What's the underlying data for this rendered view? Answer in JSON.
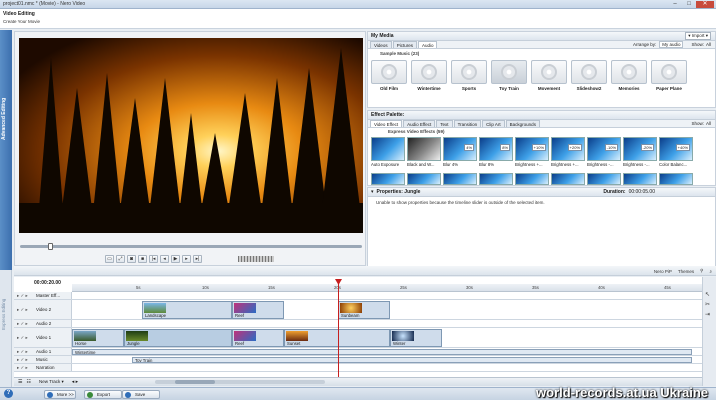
{
  "window": {
    "title": "project01.nmc * (Movie) - Nero Video",
    "min": "–",
    "max": "□",
    "close": "✕"
  },
  "header": {
    "title": "Video Editing",
    "subtitle": "Create Your Movie"
  },
  "left_tab": {
    "label": "Advanced Editing"
  },
  "left_tab2": {
    "label": "Express Editing"
  },
  "my_media": {
    "title": "My Media",
    "import_label": "▾ Import ▾",
    "tabs": [
      "Videos",
      "Pictures",
      "Audio"
    ],
    "arrange_label": "Arrange by:",
    "arrange_value": "My audio",
    "show_label": "Show:",
    "show_value": "All",
    "section": "Sample Music (23)",
    "items": [
      "Old Film",
      "Wintertime",
      "Sports",
      "Toy Train",
      "Movement",
      "Slideshow2",
      "Memories",
      "Paper Plane"
    ]
  },
  "effect_palette": {
    "title": "Effect Palette:",
    "tabs": [
      "Video Effect",
      "Audio Effect",
      "Text",
      "Transition",
      "Clip Art",
      "Backgrounds"
    ],
    "show_label": "Show:",
    "show_value": "All",
    "section": "Express Video Effects (59)",
    "items": [
      {
        "label": "Auto Exposure",
        "badge": ""
      },
      {
        "label": "Black and W...",
        "badge": ""
      },
      {
        "label": "Blur 4%",
        "badge": "4%"
      },
      {
        "label": "Blur 8%",
        "badge": "8%"
      },
      {
        "label": "Brightness +...",
        "badge": "+10%"
      },
      {
        "label": "Brightness +...",
        "badge": "+20%"
      },
      {
        "label": "Brightness -...",
        "badge": "-10%"
      },
      {
        "label": "Brightness -...",
        "badge": "-20%"
      },
      {
        "label": "Color Balanc...",
        "badge": "+40%"
      }
    ]
  },
  "properties": {
    "title": "Properties: Jungle",
    "duration_label": "Duration:",
    "duration_value": "00:00:05.00",
    "message": "Unable to show properties because the timeline slider is outside of the selected item."
  },
  "timeline_toolbar": {
    "nero_pip": "Nero PiP",
    "themes": "Themes"
  },
  "timeline": {
    "timecode": "00:00:20.00",
    "ruler": [
      "5s",
      "10s",
      "15s",
      "20s",
      "25s",
      "30s",
      "35s",
      "40s",
      "45s",
      "50s"
    ],
    "tracks": [
      "Master Eff...",
      "Video 2",
      "Audio 2",
      "Video 1",
      "Audio 1",
      "Music",
      "Narration"
    ],
    "video2_clips": [
      "Landscape",
      "Reef",
      "Sunbeam"
    ],
    "video1_clips": [
      "Horse",
      "Jungle",
      "Reef",
      "Sunset",
      "Winter"
    ],
    "audio1_clip": "Wintertime",
    "music_clip": "Toy Train",
    "new_track": "New Track ▾"
  },
  "footer": {
    "help": "?",
    "more": "More >>",
    "export": "Export",
    "save": "Save",
    "watermark": "world-records.at.ua  Ukraine"
  }
}
